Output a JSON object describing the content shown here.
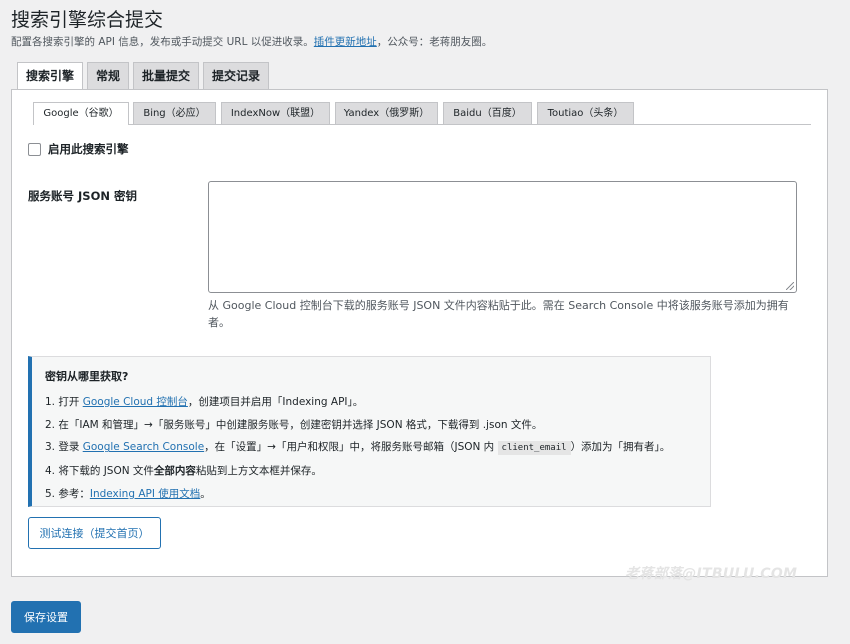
{
  "header": {
    "title": "搜索引擎综合提交",
    "desc_prefix": "配置各搜索引擎的 API 信息，发布或手动提交 URL 以促进收录。",
    "desc_link": "插件更新地址",
    "desc_suffix": "，公众号：老蒋朋友圈。"
  },
  "nav_tabs": [
    {
      "label": "搜索引擎",
      "active": true
    },
    {
      "label": "常规",
      "active": false
    },
    {
      "label": "批量提交",
      "active": false
    },
    {
      "label": "提交记录",
      "active": false
    }
  ],
  "engine_tabs": [
    {
      "label": "Google（谷歌）",
      "active": true
    },
    {
      "label": "Bing（必应）",
      "active": false
    },
    {
      "label": "IndexNow（联盟）",
      "active": false
    },
    {
      "label": "Yandex（俄罗斯）",
      "active": false
    },
    {
      "label": "Baidu（百度）",
      "active": false
    },
    {
      "label": "Toutiao（头条）",
      "active": false
    }
  ],
  "enable": {
    "label": "启用此搜索引擎",
    "checked": false
  },
  "json_key": {
    "label": "服务账号 JSON 密钥",
    "value": "",
    "help": "从 Google Cloud 控制台下载的服务账号 JSON 文件内容粘贴于此。需在 Search Console 中将该服务账号添加为拥有者。"
  },
  "notice": {
    "title": "密钥从哪里获取?",
    "step1_prefix": "1. 打开 ",
    "step1_link": "Google Cloud 控制台",
    "step1_suffix": "，创建项目并启用「Indexing API」。",
    "step2": "2. 在「IAM 和管理」→「服务账号」中创建服务账号，创建密钥并选择 JSON 格式，下载得到 .json 文件。",
    "step3_prefix": "3. 登录 ",
    "step3_link": "Google Search Console",
    "step3_middle": "，在「设置」→「用户和权限」中，将服务账号邮箱（JSON 内 ",
    "step3_code": "client_email",
    "step3_suffix": "）添加为「拥有者」。",
    "step4_prefix": "4. 将下载的 JSON 文件",
    "step4_bold": "全部内容",
    "step4_suffix": "粘贴到上方文本框并保存。",
    "step5_prefix": "5. 参考：",
    "step5_link": "Indexing API 使用文档",
    "step5_suffix": "。"
  },
  "test_button": {
    "label": "测试连接（提交首页）"
  },
  "watermark": "老蒋部落@ITBULU.COM",
  "save_button": {
    "label": "保存设置"
  },
  "colors": {
    "accent": "#2271b1",
    "background": "#f0f0f1",
    "panel": "#ffffff",
    "tab_inactive": "#dcdcde"
  }
}
